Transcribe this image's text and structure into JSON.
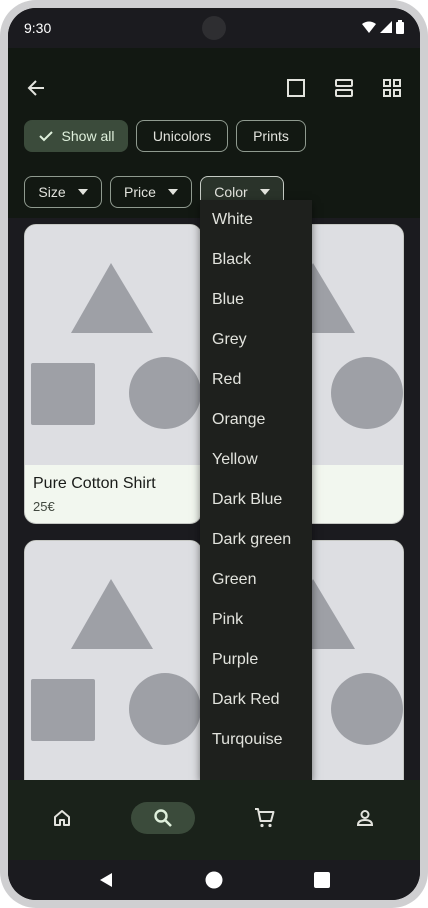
{
  "status_bar": {
    "time": "9:30"
  },
  "filters": {
    "row1": [
      {
        "label": "Show all",
        "selected": true
      },
      {
        "label": "Unicolors",
        "selected": false
      },
      {
        "label": "Prints",
        "selected": false
      }
    ],
    "row2": [
      {
        "label": "Size"
      },
      {
        "label": "Price"
      },
      {
        "label": "Color"
      }
    ]
  },
  "products": [
    {
      "title": "Pure Cotton Shirt",
      "price": "25€"
    }
  ],
  "color_menu": {
    "items": [
      "White",
      "Black",
      "Blue",
      "Grey",
      "Red",
      "Orange",
      "Yellow",
      "Dark Blue",
      "Dark green",
      "Green",
      "Pink",
      "Purple",
      "Dark Red",
      "Turqouise"
    ]
  },
  "icons": {
    "back": "arrow-back-icon",
    "view_single": "square-icon",
    "view_list": "view-list-icon",
    "view_grid": "grid-icon",
    "nav": [
      "home-icon",
      "search-icon",
      "cart-icon",
      "person-icon"
    ]
  },
  "colors": {
    "accent": "#3b4b3b",
    "surface": "#121812",
    "card": "#f2f7ef"
  }
}
